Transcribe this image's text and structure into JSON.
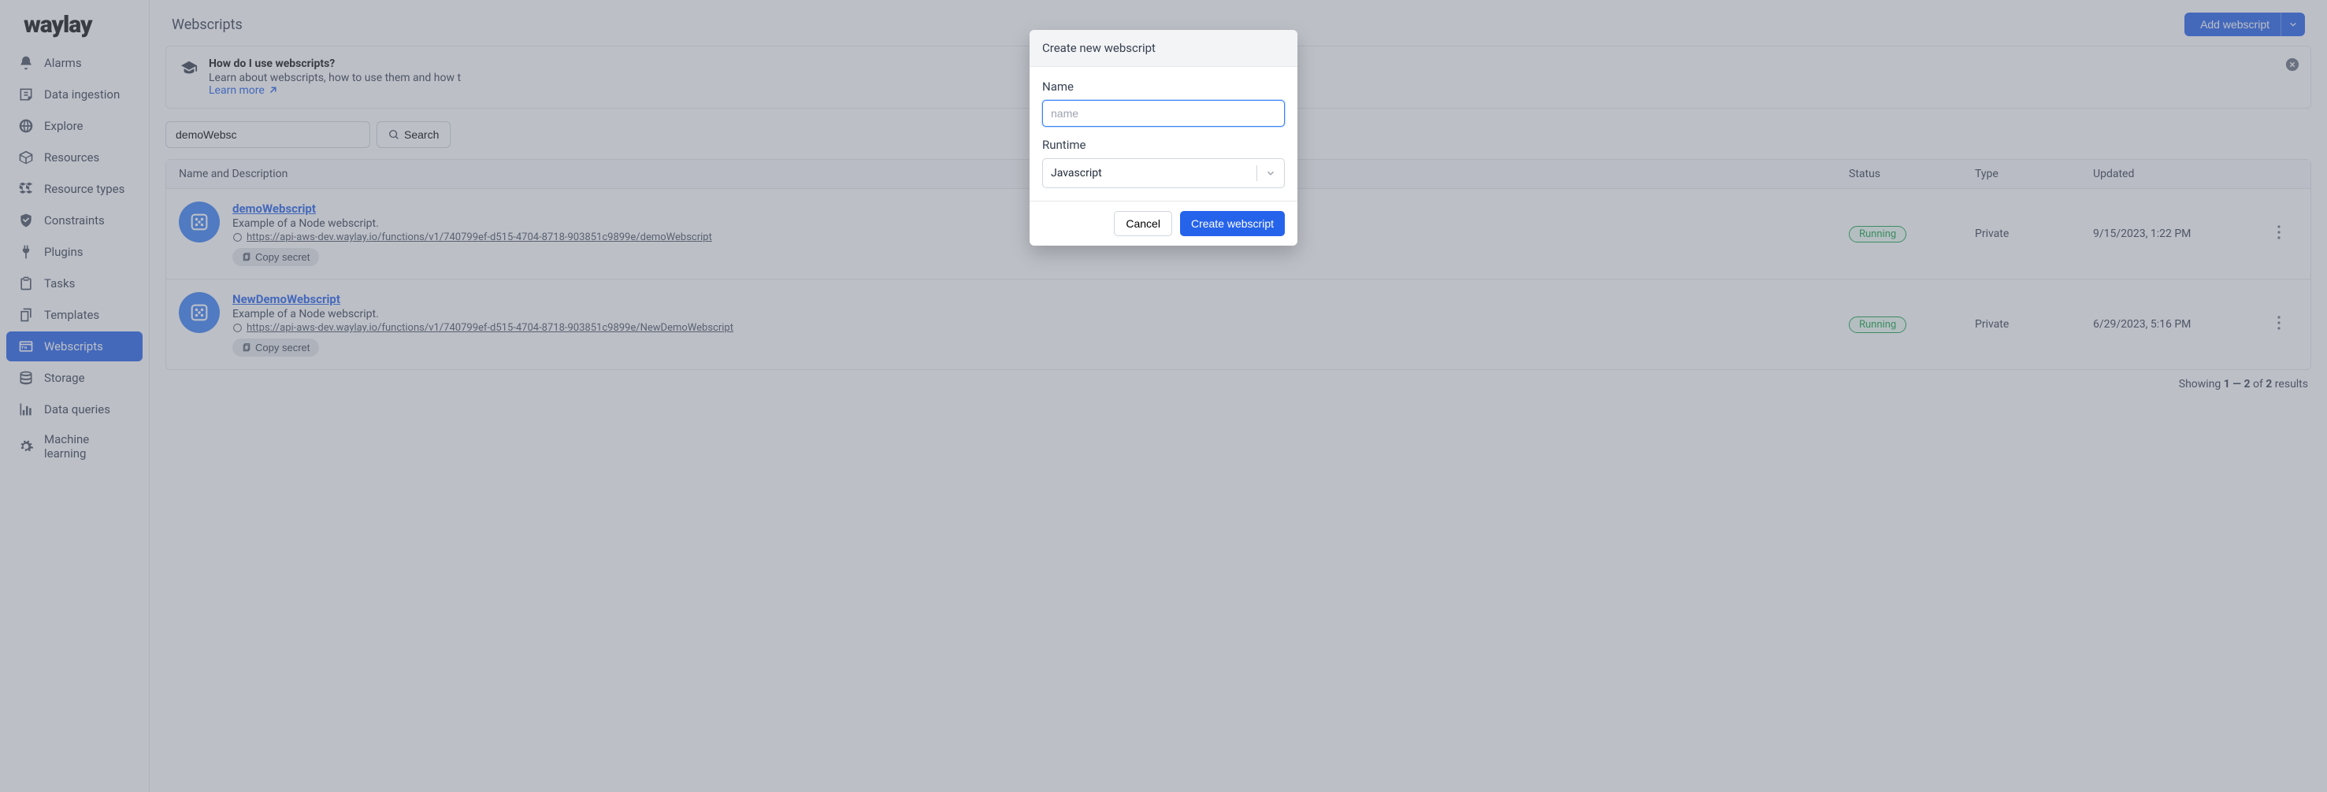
{
  "logo": "waylay",
  "sidebar": {
    "items": [
      {
        "label": "Alarms",
        "icon": "bell"
      },
      {
        "label": "Data ingestion",
        "icon": "inbox"
      },
      {
        "label": "Explore",
        "icon": "globe"
      },
      {
        "label": "Resources",
        "icon": "box"
      },
      {
        "label": "Resource types",
        "icon": "boxes"
      },
      {
        "label": "Constraints",
        "icon": "shield"
      },
      {
        "label": "Plugins",
        "icon": "plug"
      },
      {
        "label": "Tasks",
        "icon": "clipboard"
      },
      {
        "label": "Templates",
        "icon": "copy"
      },
      {
        "label": "Webscripts",
        "icon": "http",
        "active": true
      },
      {
        "label": "Storage",
        "icon": "database"
      },
      {
        "label": "Data queries",
        "icon": "chart"
      },
      {
        "label": "Machine learning",
        "icon": "gear"
      }
    ]
  },
  "header": {
    "title": "Webscripts",
    "add_button": "Add webscript"
  },
  "banner": {
    "title": "How do I use webscripts?",
    "text": "Learn about webscripts, how to use them and how t",
    "link": "Learn more"
  },
  "search": {
    "value": "demoWebsc",
    "button": "Search"
  },
  "table": {
    "columns": {
      "name": "Name and Description",
      "status": "Status",
      "type": "Type",
      "updated": "Updated"
    },
    "rows": [
      {
        "title": "demoWebscript",
        "desc": "Example of a Node webscript.",
        "url": "https://api-aws-dev.waylay.io/functions/v1/740799ef-d515-4704-8718-903851c9899e/demoWebscript",
        "copy": "Copy secret",
        "status": "Running",
        "type": "Private",
        "updated": "9/15/2023, 1:22 PM"
      },
      {
        "title": "NewDemoWebscript",
        "desc": "Example of a Node webscript.",
        "url": "https://api-aws-dev.waylay.io/functions/v1/740799ef-d515-4704-8718-903851c9899e/NewDemoWebscript",
        "copy": "Copy secret",
        "status": "Running",
        "type": "Private",
        "updated": "6/29/2023, 5:16 PM"
      }
    ]
  },
  "footer": {
    "prefix": "Showing ",
    "from": "1",
    "dash": " — ",
    "to": "2",
    "of_text": " of ",
    "total": "2",
    "suffix": " results"
  },
  "modal": {
    "title": "Create new webscript",
    "name_label": "Name",
    "name_placeholder": "name",
    "runtime_label": "Runtime",
    "runtime_value": "Javascript",
    "cancel": "Cancel",
    "submit": "Create webscript"
  }
}
